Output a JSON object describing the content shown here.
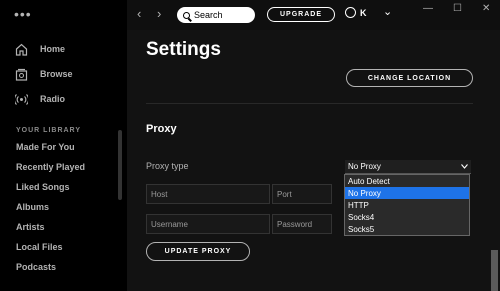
{
  "window": {
    "minimize": "—",
    "maximize": "☐",
    "close": "✕"
  },
  "topbar": {
    "back_glyph": "‹",
    "forward_glyph": "›",
    "search_placeholder": "Search",
    "upgrade_label": "UPGRADE",
    "user_initial": "K",
    "menu_glyph": "⌄"
  },
  "sidebar": {
    "menu_glyph": "•••",
    "nav": [
      {
        "label": "Home",
        "icon": "home-icon"
      },
      {
        "label": "Browse",
        "icon": "browse-icon"
      },
      {
        "label": "Radio",
        "icon": "radio-icon"
      }
    ],
    "library_title": "YOUR LIBRARY",
    "library": [
      "Made For You",
      "Recently Played",
      "Liked Songs",
      "Albums",
      "Artists",
      "Local Files",
      "Podcasts"
    ]
  },
  "main": {
    "title": "Settings",
    "change_location_label": "CHANGE LOCATION",
    "proxy_heading": "Proxy",
    "proxy_type_label": "Proxy type",
    "proxy_type_value": "No Proxy",
    "host_placeholder": "Host",
    "port_placeholder": "Port",
    "username_placeholder": "Username",
    "password_placeholder": "Password",
    "update_proxy_label": "UPDATE PROXY",
    "proxy_options": [
      "Auto Detect",
      "No Proxy",
      "HTTP",
      "Socks4",
      "Socks5"
    ],
    "selected_option": "No Proxy"
  },
  "colors": {
    "accent_selection": "#1e73e8",
    "background": "#121212",
    "sidebar": "#000000"
  }
}
